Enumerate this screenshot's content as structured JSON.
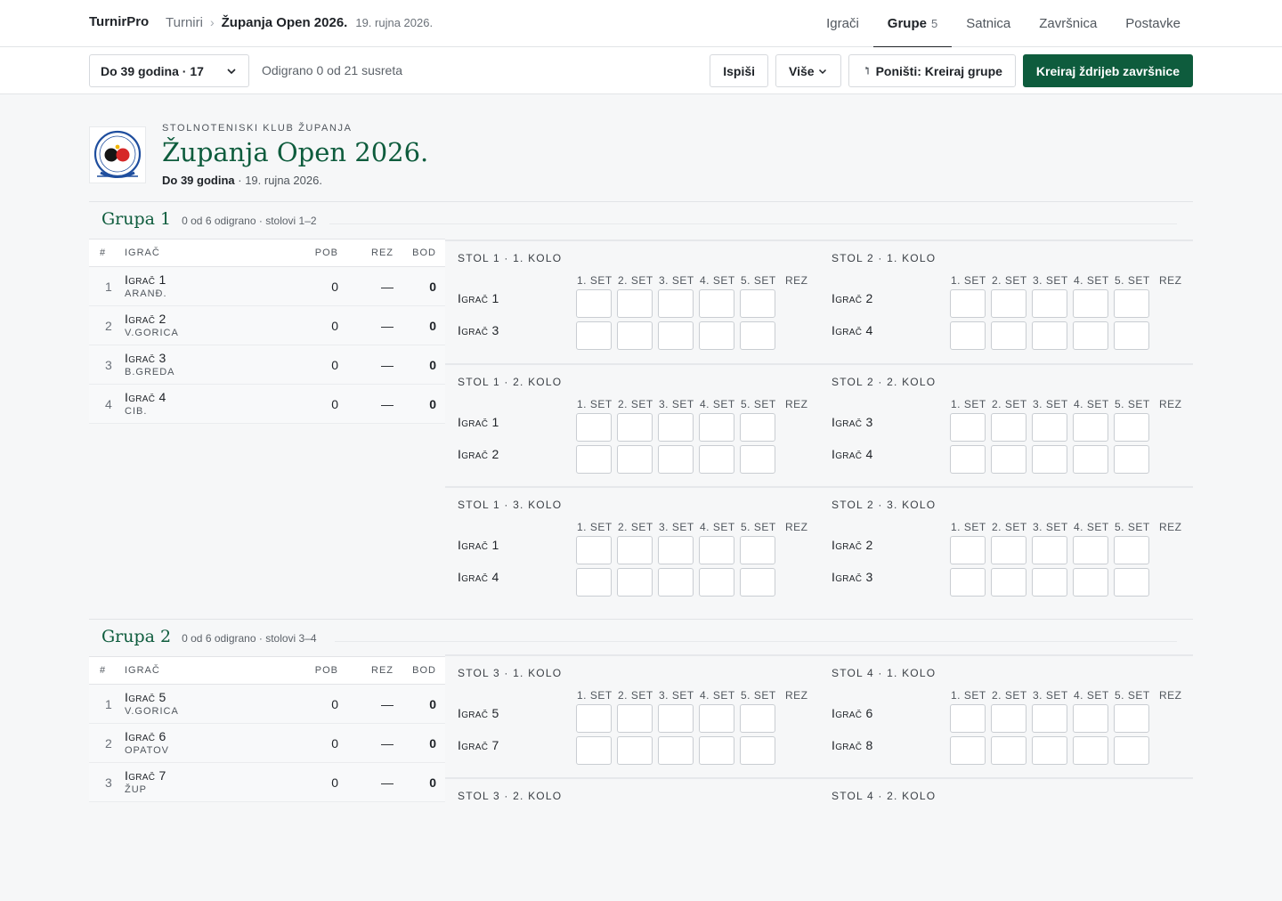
{
  "app": {
    "brand": "TurnirPro"
  },
  "breadcrumb": {
    "root": "Turniri",
    "separator": "›",
    "current": "Županja Open 2026.",
    "date": "19. rujna 2026."
  },
  "nav": [
    {
      "label": "Igrači",
      "count": ""
    },
    {
      "label": "Grupe",
      "count": "5",
      "active": true
    },
    {
      "label": "Satnica",
      "count": ""
    },
    {
      "label": "Završnica",
      "count": ""
    },
    {
      "label": "Postavke",
      "count": ""
    }
  ],
  "toolbar": {
    "category": "Do 39 godina · 17",
    "progress": "Odigrano 0 od 21 susreta",
    "print": "Ispiši",
    "more": "Više",
    "undo": "Poništi: Kreiraj grupe",
    "create": "Kreiraj ždrijeb završnice"
  },
  "header": {
    "club": "STOLNOTENISKI KLUB ŽUPANJA",
    "title": "Županja Open 2026.",
    "category": "Do 39 godina",
    "date": "· 19. rujna 2026."
  },
  "table_headers": {
    "rank": "#",
    "player": "IGRAČ",
    "wins": "POB",
    "result": "REZ",
    "points": "BOD"
  },
  "set_labels": [
    "1. SET",
    "2. SET",
    "3. SET",
    "4. SET",
    "5. SET",
    "REZ"
  ],
  "groups": [
    {
      "title": "Grupa 1",
      "meta": "0 od 6 odigrano · stolovi 1–2",
      "standings": [
        {
          "rank": "1",
          "name": "Igrač 1",
          "club": "ARANĐ.",
          "wins": "0",
          "result": "—",
          "points": "0"
        },
        {
          "rank": "2",
          "name": "Igrač 2",
          "club": "V.GORICA",
          "wins": "0",
          "result": "—",
          "points": "0"
        },
        {
          "rank": "3",
          "name": "Igrač 3",
          "club": "B.GREDA",
          "wins": "0",
          "result": "—",
          "points": "0"
        },
        {
          "rank": "4",
          "name": "Igrač 4",
          "club": "CIB.",
          "wins": "0",
          "result": "—",
          "points": "0"
        }
      ],
      "matches": [
        {
          "title": "STOL 1 · 1. KOLO",
          "p1": "Igrač 1",
          "p2": "Igrač 3"
        },
        {
          "title": "STOL 2 · 1. KOLO",
          "p1": "Igrač 2",
          "p2": "Igrač 4"
        },
        {
          "title": "STOL 1 · 2. KOLO",
          "p1": "Igrač 1",
          "p2": "Igrač 2"
        },
        {
          "title": "STOL 2 · 2. KOLO",
          "p1": "Igrač 3",
          "p2": "Igrač 4"
        },
        {
          "title": "STOL 1 · 3. KOLO",
          "p1": "Igrač 1",
          "p2": "Igrač 4"
        },
        {
          "title": "STOL 2 · 3. KOLO",
          "p1": "Igrač 2",
          "p2": "Igrač 3"
        }
      ]
    },
    {
      "title": "Grupa 2",
      "meta": "0 od 6 odigrano · stolovi 3–4",
      "standings": [
        {
          "rank": "1",
          "name": "Igrač 5",
          "club": "V.GORICA",
          "wins": "0",
          "result": "—",
          "points": "0"
        },
        {
          "rank": "2",
          "name": "Igrač 6",
          "club": "OPATOV",
          "wins": "0",
          "result": "—",
          "points": "0"
        },
        {
          "rank": "3",
          "name": "Igrač 7",
          "club": "ŽUP",
          "wins": "0",
          "result": "—",
          "points": "0"
        }
      ],
      "matches": [
        {
          "title": "STOL 3 · 1. KOLO",
          "p1": "Igrač 5",
          "p2": "Igrač 7"
        },
        {
          "title": "STOL 4 · 1. KOLO",
          "p1": "Igrač 6",
          "p2": "Igrač 8"
        },
        {
          "title": "STOL 3 · 2. KOLO",
          "p1": "",
          "p2": ""
        },
        {
          "title": "STOL 4 · 2. KOLO",
          "p1": "",
          "p2": ""
        }
      ]
    }
  ]
}
